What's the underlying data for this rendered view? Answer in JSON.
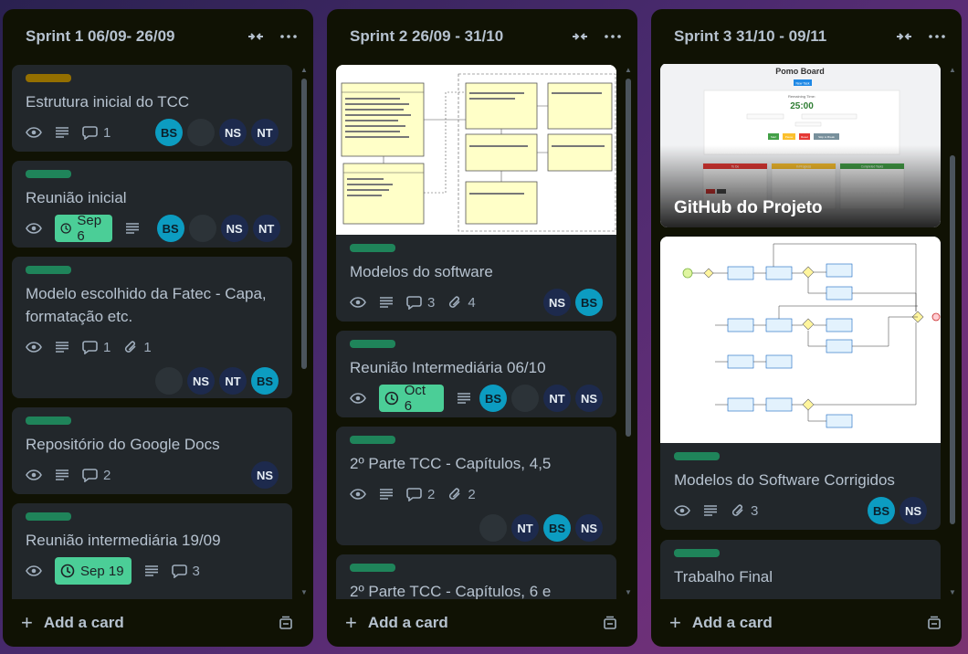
{
  "colors": {
    "label_yellow": "#946f00",
    "label_green": "#1f845a",
    "due_green": "#4bce97"
  },
  "icons": {
    "collapse": "collapse-arrows-icon",
    "more": "more-dots-icon",
    "watch": "eye-icon",
    "description": "description-icon",
    "comments": "comment-icon",
    "attachments": "paperclip-icon",
    "due": "clock-icon",
    "add": "plus-icon",
    "template": "card-template-icon"
  },
  "add_card_label": "Add a card",
  "lists": [
    {
      "title": "Sprint 1 06/09- 26/09",
      "cards": [
        {
          "title": "Estrutura inicial do TCC",
          "label": "yellow",
          "comments": "1",
          "members": [
            "BS",
            "",
            "NS",
            "NT"
          ]
        },
        {
          "title": "Reunião inicial",
          "label": "green",
          "due": "Sep 6",
          "members": [
            "BS",
            "",
            "NS",
            "NT"
          ]
        },
        {
          "title": "Modelo escolhido da Fatec - Capa, formatação etc.",
          "label": "green",
          "comments": "1",
          "attachments": "1",
          "members": [
            "",
            "NS",
            "NT",
            "BS"
          ]
        },
        {
          "title": "Repositório do Google Docs",
          "label": "green",
          "comments": "2",
          "members": [
            "NS"
          ]
        },
        {
          "title": "Reunião intermediária 19/09",
          "label": "green",
          "due": "Sep 19",
          "comments": "3"
        }
      ]
    },
    {
      "title": "Sprint 2 26/09 - 31/10",
      "cards": [
        {
          "title": "Modelos do software",
          "label": "green",
          "comments": "3",
          "attachments": "4",
          "members": [
            "NS",
            "BS"
          ]
        },
        {
          "title": "Reunião Intermediária 06/10",
          "label": "green",
          "due": "Oct 6",
          "members": [
            "BS",
            "",
            "NT",
            "NS"
          ]
        },
        {
          "title": "2º Parte TCC - Capítulos, 4,5",
          "label": "green",
          "comments": "2",
          "attachments": "2",
          "members": [
            "",
            "NT",
            "BS",
            "NS"
          ]
        },
        {
          "title": "2º Parte TCC - Capítulos, 6 e",
          "label": "green"
        }
      ]
    },
    {
      "title": "Sprint 3 31/10 - 09/11",
      "cards": [
        {
          "title": "GitHub do Projeto",
          "cover": {
            "app_title": "Pomo Board",
            "new_task": "New Task",
            "timer_label": "Remaining Time:",
            "timer": "25:00",
            "start": "Start",
            "pause": "Pause",
            "reset": "Reset",
            "skip": "Skip to Break",
            "col_todo": "To Do",
            "col_progress": "In Progress",
            "col_done": "Completed Tasks"
          }
        },
        {
          "title": "Modelos do Software Corrigidos",
          "label": "green",
          "attachments": "3",
          "members": [
            "BS",
            "NS"
          ]
        },
        {
          "title": "Trabalho Final",
          "label": "green"
        }
      ]
    }
  ]
}
